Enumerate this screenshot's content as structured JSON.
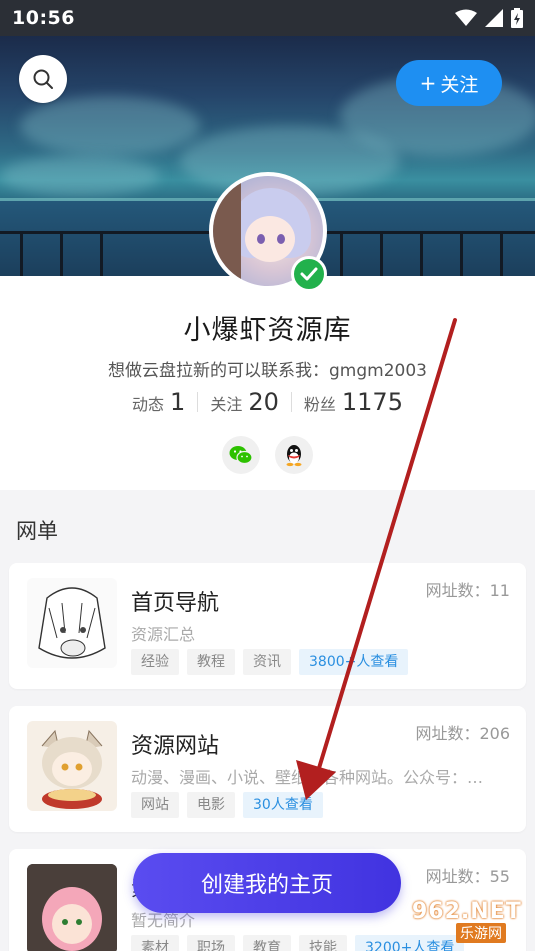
{
  "status_bar": {
    "time": "10:56"
  },
  "header": {
    "follow_label": "关注",
    "follow_plus": "+"
  },
  "profile": {
    "name": "小爆虾资源库",
    "bio": "想做云盘拉新的可以联系我：gmgm2003",
    "stats": [
      {
        "label": "动态",
        "value": "1"
      },
      {
        "label": "关注",
        "value": "20"
      },
      {
        "label": "粉丝",
        "value": "1175"
      }
    ],
    "socials": [
      "wechat-icon",
      "qq-icon"
    ]
  },
  "section": {
    "title": "网单"
  },
  "cards": [
    {
      "title": "首页导航",
      "count": "网址数：11",
      "desc": "资源汇总",
      "tags": [
        "经验",
        "教程",
        "资讯"
      ],
      "views": "3800+人查看"
    },
    {
      "title": "资源网站",
      "count": "网址数：206",
      "desc": "动漫、漫画、小说、壁纸等各种网站。公众号：…",
      "tags": [
        "网站",
        "电影"
      ],
      "views": "30人查看"
    },
    {
      "title": "素",
      "count": "网址数：55",
      "desc": "暂无简介",
      "tags": [
        "素材",
        "职场",
        "教育",
        "技能"
      ],
      "views": "3200+人查看"
    }
  ],
  "create_button": {
    "label": "创建我的主页"
  },
  "watermark": {
    "main": "962.NET",
    "sub": "乐游网"
  },
  "colors": {
    "accent": "#1e8ff2",
    "create_button": "#4a3ce8",
    "verified": "#22b14c",
    "arrow": "#b21f1f"
  }
}
